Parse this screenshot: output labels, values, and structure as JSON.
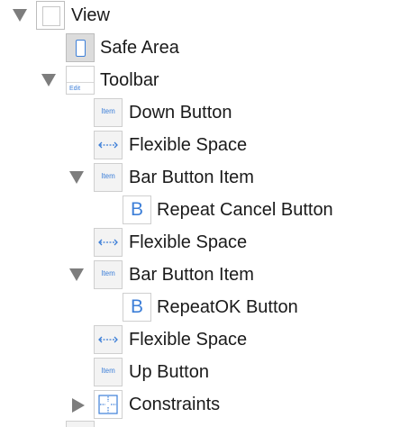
{
  "outline": {
    "view": {
      "label": "View",
      "disclosure": "expanded"
    },
    "safe_area": {
      "label": "Safe Area"
    },
    "toolbar": {
      "label": "Toolbar",
      "icon_text": "Edit",
      "disclosure": "expanded"
    },
    "down_button": {
      "label": "Down Button",
      "icon_text": "Item"
    },
    "flexible_space_1": {
      "label": "Flexible Space"
    },
    "bar_button_item_1": {
      "label": "Bar Button Item",
      "icon_text": "Item",
      "disclosure": "expanded"
    },
    "repeat_cancel_button": {
      "label": "Repeat Cancel Button",
      "icon_text": "B"
    },
    "flexible_space_2": {
      "label": "Flexible Space"
    },
    "bar_button_item_2": {
      "label": "Bar Button Item",
      "icon_text": "Item",
      "disclosure": "expanded"
    },
    "repeat_ok_button": {
      "label": "RepeatOK Button",
      "icon_text": "B"
    },
    "flexible_space_3": {
      "label": "Flexible Space"
    },
    "up_button": {
      "label": "Up Button",
      "icon_text": "Item"
    },
    "constraints": {
      "label": "Constraints",
      "disclosure": "collapsed"
    }
  },
  "colors": {
    "accent": "#3d7fd8",
    "icon_bg": "#f3f3f3",
    "disclosure": "#7d7d7d"
  }
}
